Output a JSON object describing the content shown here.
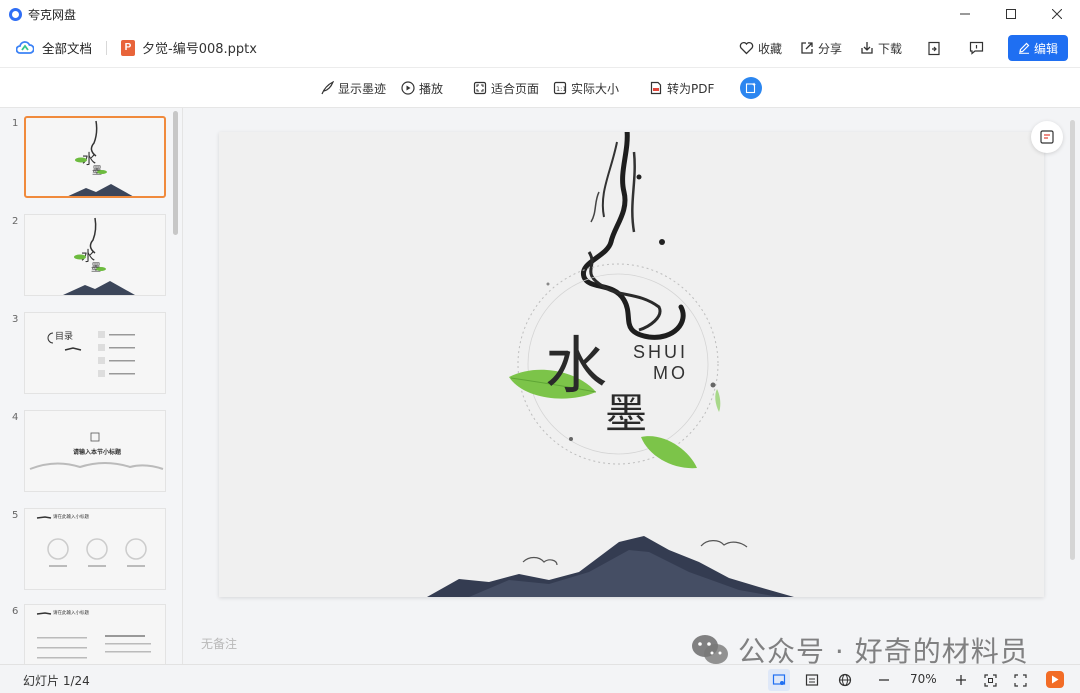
{
  "app": {
    "name": "夸克网盘"
  },
  "header": {
    "home_label": "全部文档",
    "file_name": "夕觉-编号008.pptx",
    "file_badge": "P",
    "favorite_label": "收藏",
    "share_label": "分享",
    "download_label": "下载",
    "edit_label": "编辑"
  },
  "toolbar": {
    "show_ink": "显示墨迹",
    "play": "播放",
    "fit_page": "适合页面",
    "actual_size": "实际大小",
    "to_pdf": "转为PDF"
  },
  "sidebar": {
    "thumbnails": [
      {
        "num": "1"
      },
      {
        "num": "2"
      },
      {
        "num": "3",
        "heading": "目录"
      },
      {
        "num": "4",
        "heading": "请输入本节小标题"
      },
      {
        "num": "5",
        "heading": "请在此输入小标题"
      },
      {
        "num": "6",
        "heading": "请在此输入小标题"
      }
    ]
  },
  "slide": {
    "title_char1": "水",
    "title_char2": "墨",
    "en_line1": "SHUI",
    "en_line2": "MO"
  },
  "notes": {
    "placeholder": "无备注"
  },
  "watermark": {
    "text": "公众号 · 好奇的材料员"
  },
  "status": {
    "slide_count": "幻灯片 1/24",
    "zoom": "70%"
  },
  "colors": {
    "accent": "#1f6ff2",
    "selected_border": "#f08a3c",
    "ppt_icon": "#e8643a",
    "play": "#f26c26"
  }
}
